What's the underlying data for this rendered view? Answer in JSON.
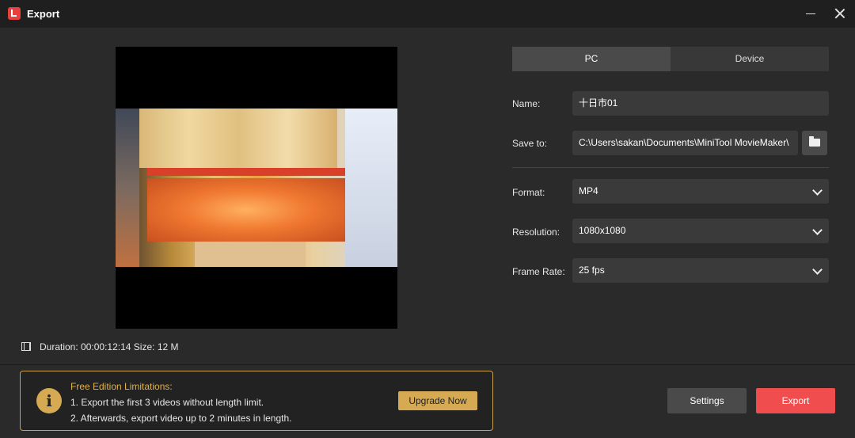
{
  "window": {
    "title": "Export"
  },
  "preview": {
    "duration_label": "Duration:",
    "duration": "00:00:12:14",
    "size_label": "Size:",
    "size": "12 M"
  },
  "tabs": [
    {
      "label": "PC"
    },
    {
      "label": "Device"
    }
  ],
  "form": {
    "name_label": "Name:",
    "name_value": "十日市01",
    "save_label": "Save to:",
    "save_value": "C:\\Users\\sakan\\Documents\\MiniTool MovieMaker\\",
    "format_label": "Format:",
    "format_value": "MP4",
    "resolution_label": "Resolution:",
    "resolution_value": "1080x1080",
    "framerate_label": "Frame Rate:",
    "framerate_value": "25 fps"
  },
  "limitations": {
    "title": "Free Edition Limitations:",
    "line1": "1. Export the first 3 videos without length limit.",
    "line2": "2. Afterwards, export video up to 2 minutes in length.",
    "upgrade_label": "Upgrade Now"
  },
  "actions": {
    "settings_label": "Settings",
    "export_label": "Export"
  },
  "colors": {
    "accent": "#f04e4e",
    "warning": "#d6aa52"
  }
}
